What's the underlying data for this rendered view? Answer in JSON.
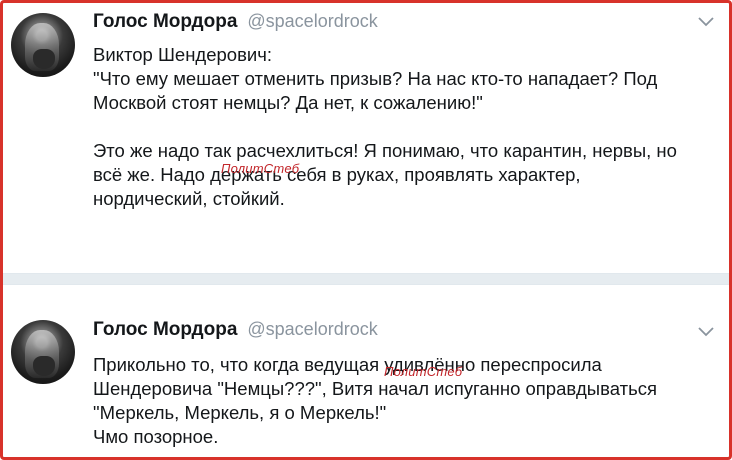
{
  "tweets": [
    {
      "author_name": "Голос Мордора",
      "author_handle": "@spacelordrock",
      "lines": [
        "Виктор Шендерович:",
        "\"Что ему мешает отменить призыв? На нас кто-то нападает? Под",
        "Москвой стоят немцы? Да нет, к сожалению!\"",
        "",
        "Это же надо так расчехлиться! Я понимаю, что карантин, нервы, но",
        "всё же. Надо держать себя в руках, проявлять характер,",
        "нордический, стойкий."
      ],
      "menu_icon": "chevron-down-icon"
    },
    {
      "author_name": "Голос Мордора",
      "author_handle": "@spacelordrock",
      "lines": [
        "Прикольно то, что когда ведущая удивлённо переспросила",
        "Шендеровича \"Немцы???\", Витя начал испуганно оправдываться",
        "\"Меркель, Меркель, я о Меркель!\"",
        "Чмо позорное."
      ],
      "menu_icon": "chevron-down-icon"
    }
  ],
  "watermarks": [
    "ПолитСтеб",
    "ПолитСтеб"
  ],
  "colors": {
    "frame_border": "#d8322a",
    "name": "#14171a",
    "handle": "#8a949e",
    "watermark": "#c2262a",
    "divider": "#e6ecf0"
  }
}
